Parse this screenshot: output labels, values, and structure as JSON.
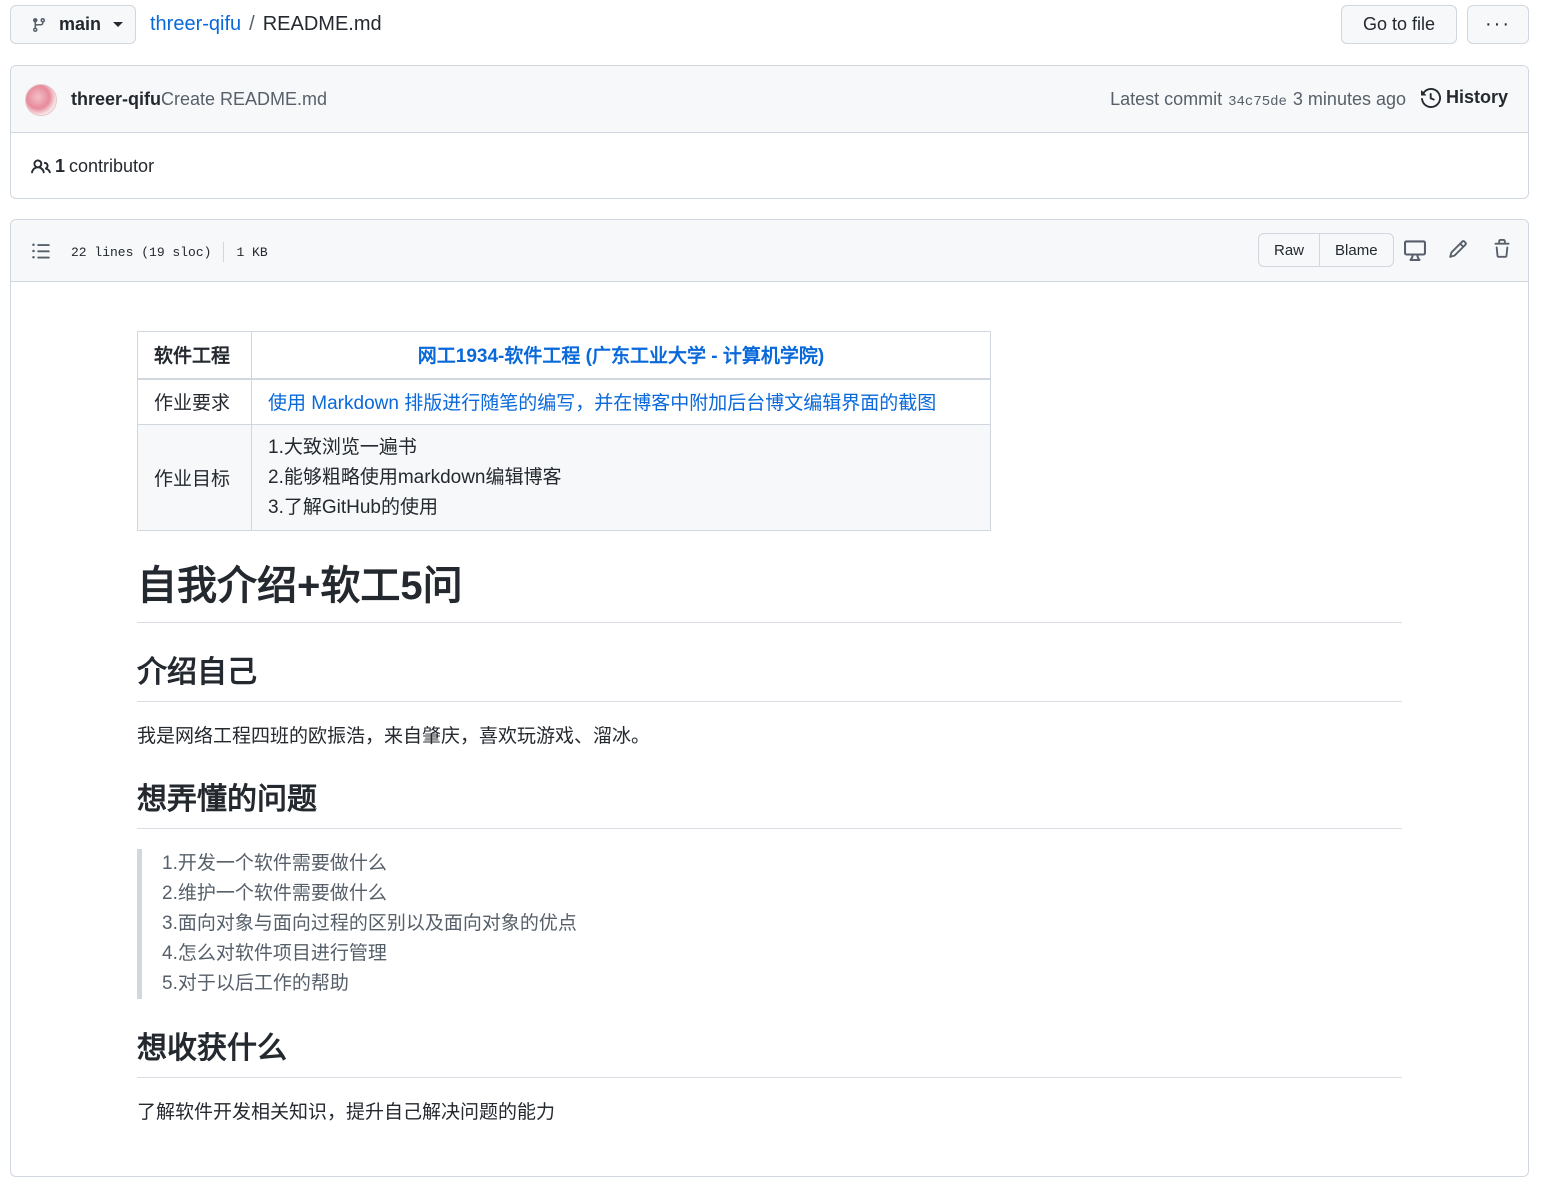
{
  "repo_nav": {
    "branch": "main",
    "repo_name": "threer-qifu",
    "separator": "/",
    "file_name": "README.md",
    "goto_file_label": "Go to file",
    "more_label": "···"
  },
  "commit": {
    "author": "threer-qifu",
    "message": "Create README.md",
    "latest_label": "Latest commit",
    "sha": "34c75de",
    "time": "3 minutes ago",
    "history_label": "History",
    "contributors_count": "1",
    "contributors_label": "contributor"
  },
  "file": {
    "lines": "22 lines (19 sloc)",
    "size": "1 KB",
    "raw_label": "Raw",
    "blame_label": "Blame"
  },
  "readme": {
    "table": {
      "h1": "软件工程",
      "h2": "网工1934-软件工程 (广东工业大学 - 计算机学院)",
      "row1_label": "作业要求",
      "row1_value": "使用 Markdown 排版进行随笔的编写，并在博客中附加后台博文编辑界面的截图",
      "row2_label": "作业目标",
      "row2_goals": [
        "1.大致浏览一遍书",
        "2.能够粗略使用markdown编辑博客",
        "3.了解GitHub的使用"
      ]
    },
    "title": "自我介绍+软工5问",
    "intro_heading": "介绍自己",
    "intro_text": "我是网络工程四班的欧振浩，来自肇庆，喜欢玩游戏、溜冰。",
    "questions_heading": "想弄懂的问题",
    "questions": [
      "1.开发一个软件需要做什么",
      "2.维护一个软件需要做什么",
      "3.面向对象与面向过程的区别以及面向对象的优点",
      "4.怎么对软件项目进行管理",
      "5.对于以后工作的帮助"
    ],
    "gain_heading": "想收获什么",
    "gain_text": "了解软件开发相关知识，提升自己解决问题的能力"
  },
  "icons": [
    "branch-icon",
    "history-icon",
    "people-icon",
    "toc-list-icon",
    "desktop-icon",
    "pencil-icon",
    "trash-icon"
  ],
  "colors": {
    "link": "#0969da",
    "border": "#d0d7de",
    "header_bg": "#f6f8fa",
    "muted": "#57606a"
  }
}
